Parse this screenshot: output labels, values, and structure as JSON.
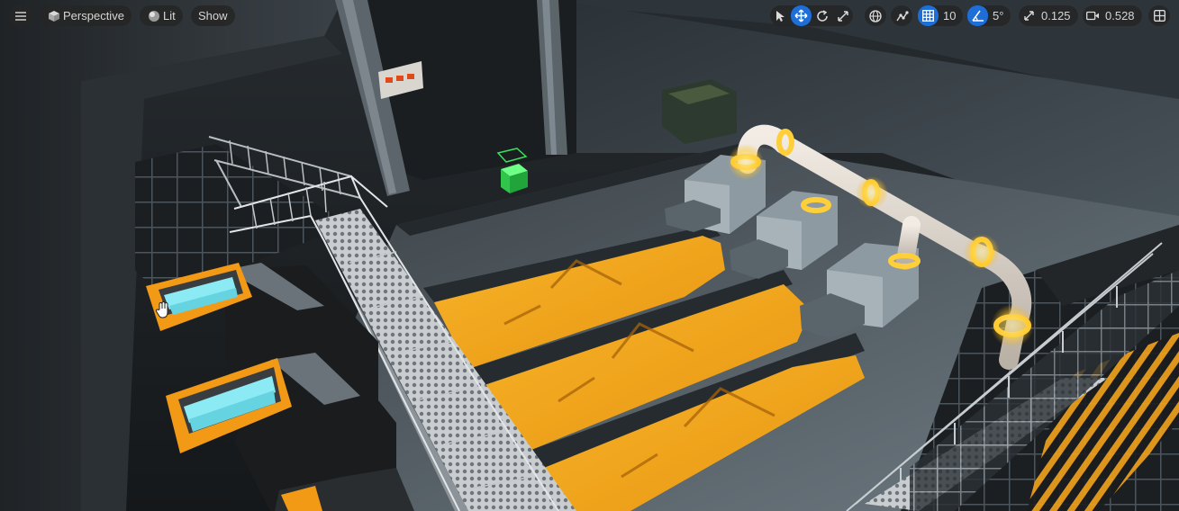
{
  "viewport": {
    "view_mode": "Perspective",
    "lighting_mode": "Lit",
    "show_menu": "Show",
    "grid_snap_value": "10",
    "rotation_snap_value": "5°",
    "scale_snap_value": "0.125",
    "camera_speed_value": "0.528"
  },
  "icons": {
    "menu": "hamburger-menu-icon",
    "perspective": "cube-icon",
    "lit": "sphere-icon",
    "select": "arrow-cursor-icon",
    "translate": "move-arrows-icon",
    "rotate": "rotate-icon",
    "scale": "scale-icon",
    "world": "globe-icon",
    "surface": "surface-snap-icon",
    "grid": "grid-icon",
    "angle": "angle-icon",
    "scale_snap": "diagonal-arrow-icon",
    "camera": "video-camera-icon",
    "layout": "viewport-layout-icon",
    "cursor": "hand-cursor-icon"
  },
  "colors": {
    "accent_active": "#1e6ed8",
    "toolbar_bg": "#262626",
    "hazard_orange": "#f2a31a",
    "emissive_yellow": "#ffd24a",
    "coolant_cyan": "#7fe6ef",
    "marker_green": "#39e05a"
  }
}
